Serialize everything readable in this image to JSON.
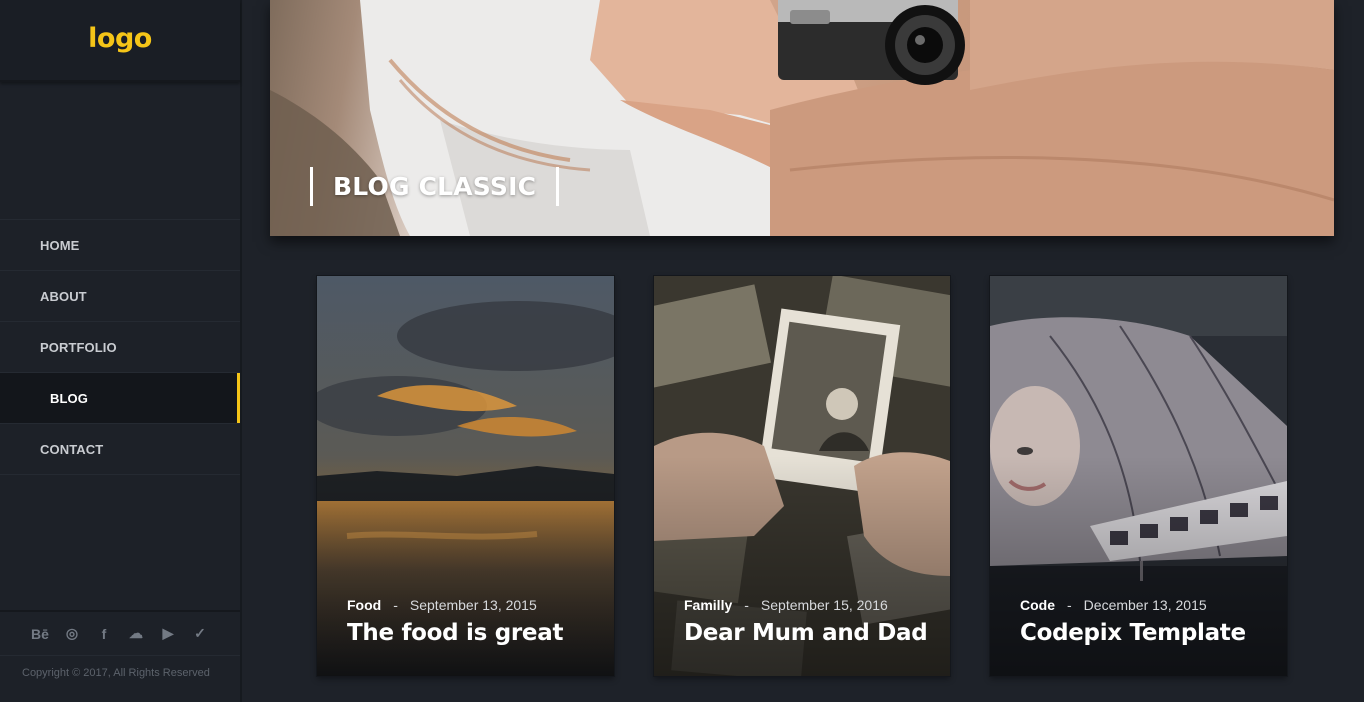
{
  "sidebar": {
    "logo": "logo",
    "nav": [
      {
        "label": "HOME"
      },
      {
        "label": "ABOUT"
      },
      {
        "label": "PORTFOLIO"
      },
      {
        "label": "BLOG"
      },
      {
        "label": "CONTACT"
      }
    ],
    "active_nav": "BLOG",
    "social": [
      {
        "icon": "behance-icon",
        "glyph": "Bē"
      },
      {
        "icon": "instagram-icon",
        "glyph": "◎"
      },
      {
        "icon": "facebook-icon",
        "glyph": "f"
      },
      {
        "icon": "soundcloud-icon",
        "glyph": "☁"
      },
      {
        "icon": "youtube-icon",
        "glyph": "▶"
      },
      {
        "icon": "twitter-icon",
        "glyph": "✓"
      }
    ],
    "copyright": "Copyright © 2017, All Rights Reserved"
  },
  "hero": {
    "title": "BLOG CLASSIC"
  },
  "posts": [
    {
      "category": "Food",
      "separator": "-",
      "date": "September 13, 2015",
      "title": "The food is great"
    },
    {
      "category": "Familly",
      "separator": "-",
      "date": "September 15, 2016",
      "title": "Dear Mum and Dad"
    },
    {
      "category": "Code",
      "separator": "-",
      "date": "December 13, 2015",
      "title": "Codepix Template"
    }
  ],
  "colors": {
    "accent": "#f5c518",
    "background": "#1e2229",
    "sidebar": "#1d2128"
  }
}
